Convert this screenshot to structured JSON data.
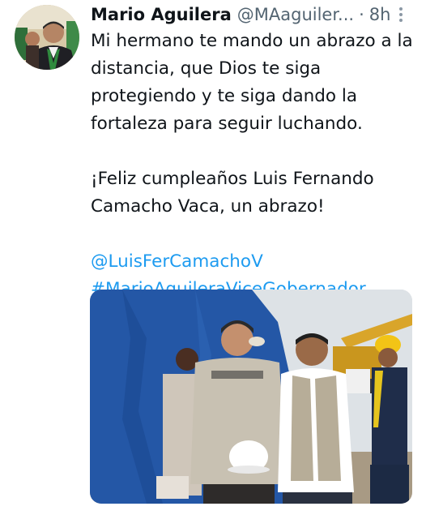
{
  "tweet": {
    "display_name": "Mario Aguilera",
    "handle": "@MAaguiler...",
    "separator": "·",
    "time": "8h",
    "text_lines": [
      "Mi hermano te mando un abrazo a la",
      "distancia, que Dios te siga",
      "protegiendo y te siga dando la",
      "fortaleza para seguir luchando."
    ],
    "text_lines_2": [
      "¡Feliz cumpleaños Luis Fernando",
      "Camacho Vaca, un abrazo!"
    ],
    "mention": "@LuisFerCamachoV",
    "hashtag": "#MarioAguileraViceGobernador"
  },
  "colors": {
    "link": "#1d9bf0",
    "secondary_text": "#536471",
    "primary_text": "#0f1419"
  },
  "icons": {
    "more": "more-vertical-icon"
  }
}
